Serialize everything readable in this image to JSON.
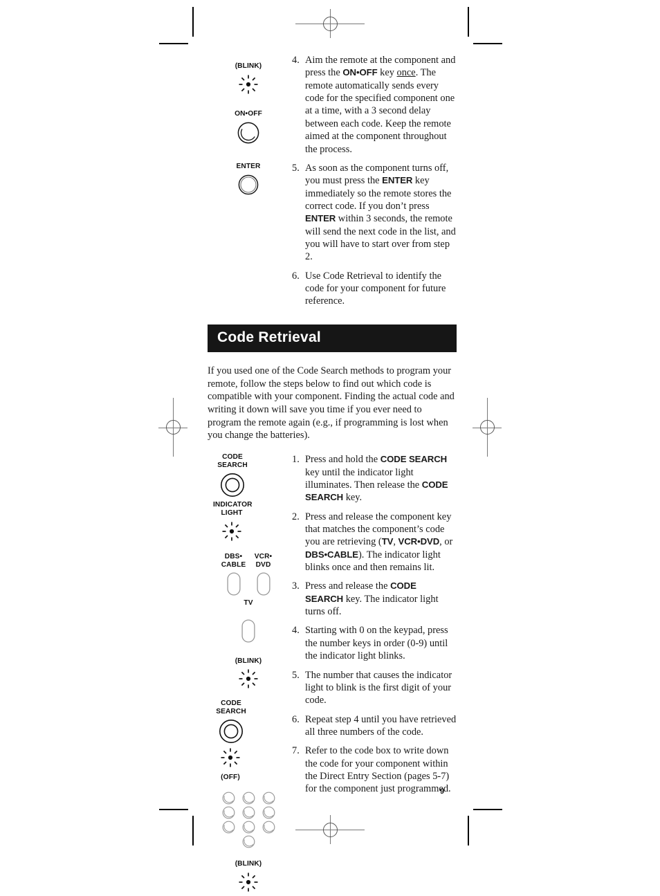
{
  "page": {
    "folio": "9"
  },
  "top_block": {
    "illustrations": [
      {
        "name": "blink-label-top",
        "label": "(BLINK)",
        "icon": "blink-icon"
      },
      {
        "name": "on-off-key",
        "label": "ON•OFF",
        "icon": "round-key-shadow-icon"
      },
      {
        "name": "enter-key",
        "label": "ENTER",
        "icon": "round-key-ring-icon"
      }
    ],
    "steps": [
      {
        "num": "4.",
        "runs": [
          {
            "t": "Aim the remote at the component and press the "
          },
          {
            "t": "ON•OFF",
            "b": true
          },
          {
            "t": " key "
          },
          {
            "t": "once",
            "u": true
          },
          {
            "t": ". The remote automatically sends every code for the specified component one at a time, with a 3 second delay between each code. Keep the remote aimed at the component throughout the process."
          }
        ]
      },
      {
        "num": "5.",
        "runs": [
          {
            "t": "As soon as the component turns off, you must press the "
          },
          {
            "t": "ENTER",
            "b": true
          },
          {
            "t": " key immediately so the remote stores the correct code. If you don’t press "
          },
          {
            "t": "ENTER",
            "b": true
          },
          {
            "t": " within 3 seconds, the remote will send the next code in the list, and you will have to start over from step 2."
          }
        ]
      },
      {
        "num": "6.",
        "runs": [
          {
            "t": "Use Code Retrieval to identify the code for your component for future reference."
          }
        ]
      }
    ]
  },
  "section": {
    "title": "Code Retrieval",
    "title_bg": "#161616",
    "title_color": "#ffffff",
    "intro": "If you used one of the Code Search methods to program your remote, follow the steps below to find out which code is compatible with your component. Finding the actual code and writing it down will save you time if you ever need to program the remote again (e.g., if programming is lost when you change the batteries)."
  },
  "retrieval_block": {
    "labels": {
      "code_search": "CODE\nSEARCH",
      "indicator_light": "INDICATOR\nLIGHT",
      "dbs_cable": "DBS•\nCABLE",
      "vcr_dvd": "VCR•\nDVD",
      "tv": "TV",
      "blink": "(BLINK)",
      "off": "(OFF)"
    },
    "steps": [
      {
        "num": "1.",
        "runs": [
          {
            "t": "Press and hold the "
          },
          {
            "t": "CODE SEARCH",
            "b": true
          },
          {
            "t": " key until the indicator light illuminates. Then release the "
          },
          {
            "t": "CODE SEARCH",
            "b": true
          },
          {
            "t": " key."
          }
        ]
      },
      {
        "num": "2.",
        "runs": [
          {
            "t": "Press and release the component key that matches the component’s code you are retrieving ("
          },
          {
            "t": "TV",
            "b": true
          },
          {
            "t": ", "
          },
          {
            "t": "VCR•DVD",
            "b": true
          },
          {
            "t": ", or "
          },
          {
            "t": "DBS•CABLE",
            "b": true
          },
          {
            "t": "). The indicator light blinks once and then remains lit."
          }
        ]
      },
      {
        "num": "3.",
        "runs": [
          {
            "t": "Press and release the "
          },
          {
            "t": "CODE SEARCH",
            "b": true
          },
          {
            "t": " key. The indicator light turns off."
          }
        ]
      },
      {
        "num": "4.",
        "runs": [
          {
            "t": "Starting with 0 on the keypad, press the number keys in order (0-9) until the indicator light blinks."
          }
        ]
      },
      {
        "num": "5.",
        "runs": [
          {
            "t": "The number that causes the indicator light to blink is the first digit of your code."
          }
        ]
      },
      {
        "num": "6.",
        "runs": [
          {
            "t": "Repeat step 4 until you have retrieved all three numbers of the code."
          }
        ]
      },
      {
        "num": "7.",
        "runs": [
          {
            "t": "Refer to the code box to write down the code for your component within the Direct Entry Section (pages 5-7) for the component just programmed."
          }
        ]
      }
    ]
  }
}
